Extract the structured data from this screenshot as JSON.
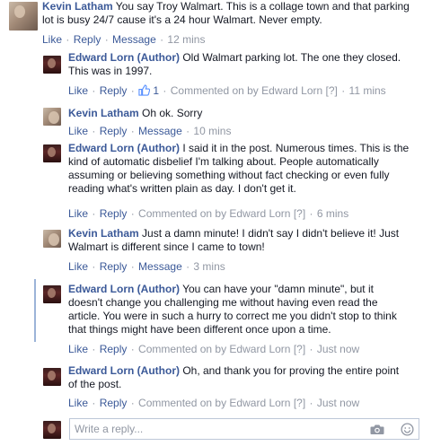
{
  "comments": [
    {
      "author": "Kevin Latham",
      "avatar": "kevin",
      "lines": [
        " You say Troy Walmart. This is a collage town and that parking",
        "lot is busy 24/7 cause it's a 24 hour Walmart. Never empty."
      ],
      "actions": {
        "like": "Like",
        "reply": "Reply",
        "message": "Message",
        "time": "12 mins"
      }
    },
    {
      "author": "Edward Lorn (Author)",
      "avatar": "edward",
      "lines": [
        " Old Walmart parking lot. The one they closed.",
        "This was in 1997."
      ],
      "actions": {
        "like": "Like",
        "reply": "Reply",
        "like_count": "1",
        "commented_by": "Commented on by Edward Lorn",
        "marker": "[?]",
        "time": "11 mins"
      }
    },
    {
      "author": "Kevin Latham",
      "avatar": "kevin",
      "lines": [
        " Oh ok. Sorry"
      ],
      "actions": {
        "like": "Like",
        "reply": "Reply",
        "message": "Message",
        "time": "10 mins"
      }
    },
    {
      "author": "Edward Lorn (Author)",
      "avatar": "edward",
      "lines": [
        " I said it in the post. Numerous times. This is the",
        "kind of automatic disbelief I'm talking about. People automatically",
        "assuming or believing something without fact checking or even fully",
        "reading what's written plain as day. I don't get it."
      ],
      "actions": {
        "like": "Like",
        "reply": "Reply",
        "commented_by": "Commented on by Edward Lorn",
        "marker": "[?]",
        "time": "6 mins"
      }
    },
    {
      "author": "Kevin Latham",
      "avatar": "kevin",
      "lines": [
        " Just a damn minute! I didn't say I didn't believe it! Just",
        "Walmart is different since I came to town!"
      ],
      "actions": {
        "like": "Like",
        "reply": "Reply",
        "message": "Message",
        "time": "3 mins"
      }
    },
    {
      "author": "Edward Lorn (Author)",
      "avatar": "edward",
      "lines": [
        " You can have your \"damn minute\", but it",
        "doesn't change you challenging me without having even read the",
        "article. You were in such a hurry to correct me you didn't stop to think",
        "that things might have been different once upon a time."
      ],
      "actions": {
        "like": "Like",
        "reply": "Reply",
        "commented_by": "Commented on by Edward Lorn",
        "marker": "[?]",
        "time": "Just now"
      }
    },
    {
      "author": "Edward Lorn (Author)",
      "avatar": "edward",
      "lines": [
        " Oh, and thank you for proving the entire point",
        "of the post."
      ],
      "actions": {
        "like": "Like",
        "reply": "Reply",
        "commented_by": "Commented on by Edward Lorn",
        "marker": "[?]",
        "time": "Just now"
      }
    }
  ],
  "reply_box": {
    "placeholder": "Write a reply..."
  },
  "icons": [
    "thumbs-up-icon",
    "camera-icon",
    "smile-icon"
  ],
  "colors": {
    "link": "#3b5998",
    "meta": "#9197a3",
    "thread_line": "#9cb4d8",
    "text": "#141823"
  }
}
